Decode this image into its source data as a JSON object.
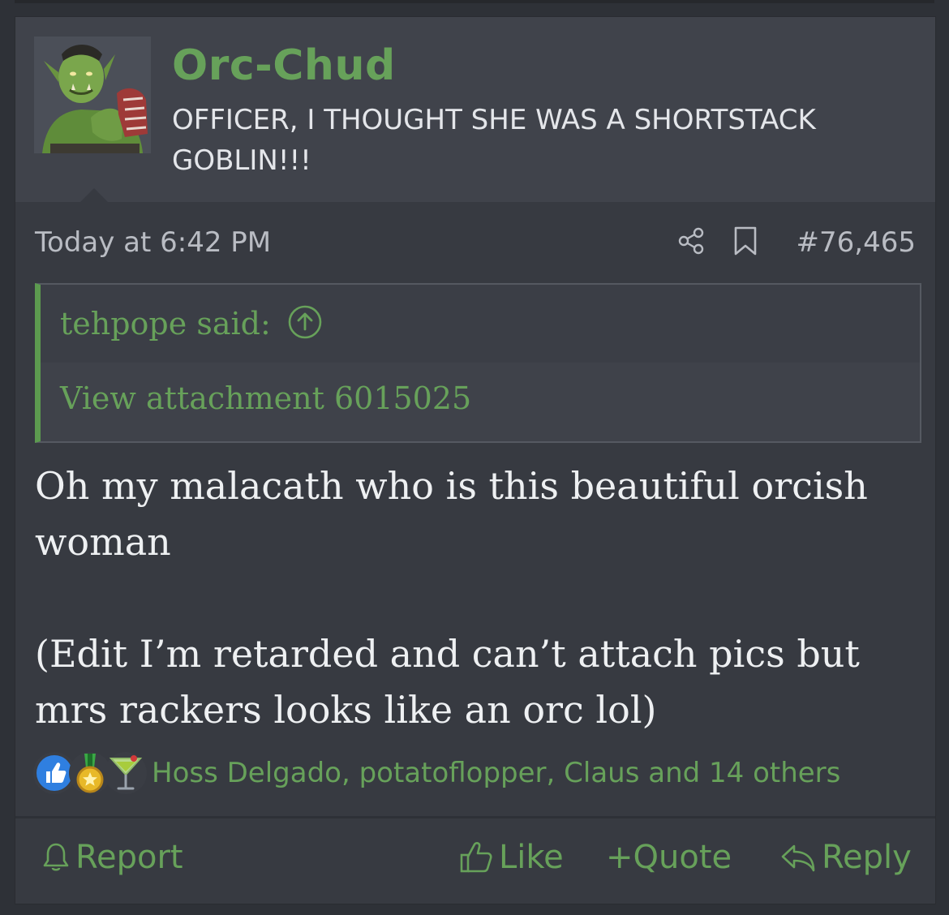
{
  "post": {
    "username": "Orc-Chud",
    "user_title": "OFFICER, I THOUGHT SHE WAS A SHORTSTACK GOBLIN!!!",
    "date": "Today at 6:42 PM",
    "post_number": "#76,465",
    "quote": {
      "author": "tehpope said:",
      "body": "View attachment 6015025"
    },
    "message": {
      "para1": "Oh my malacath who is this beautiful orcish woman",
      "para2": "(Edit I’m retarded and can’t attach pics but mrs rackers looks like an orc lol)"
    },
    "reactions": {
      "users": "Hoss Delgado, potatoflopper, Claus and 14 others",
      "icons": [
        "like-reaction-icon",
        "medal-reaction-icon",
        "cocktail-reaction-icon"
      ]
    },
    "actions": {
      "report": "Report",
      "like": "Like",
      "quote": "+Quote",
      "reply": "Reply"
    }
  },
  "colors": {
    "accent_green": "#67a15a",
    "background": "#373a41",
    "header": "#40434b",
    "text": "#eef0f2"
  }
}
